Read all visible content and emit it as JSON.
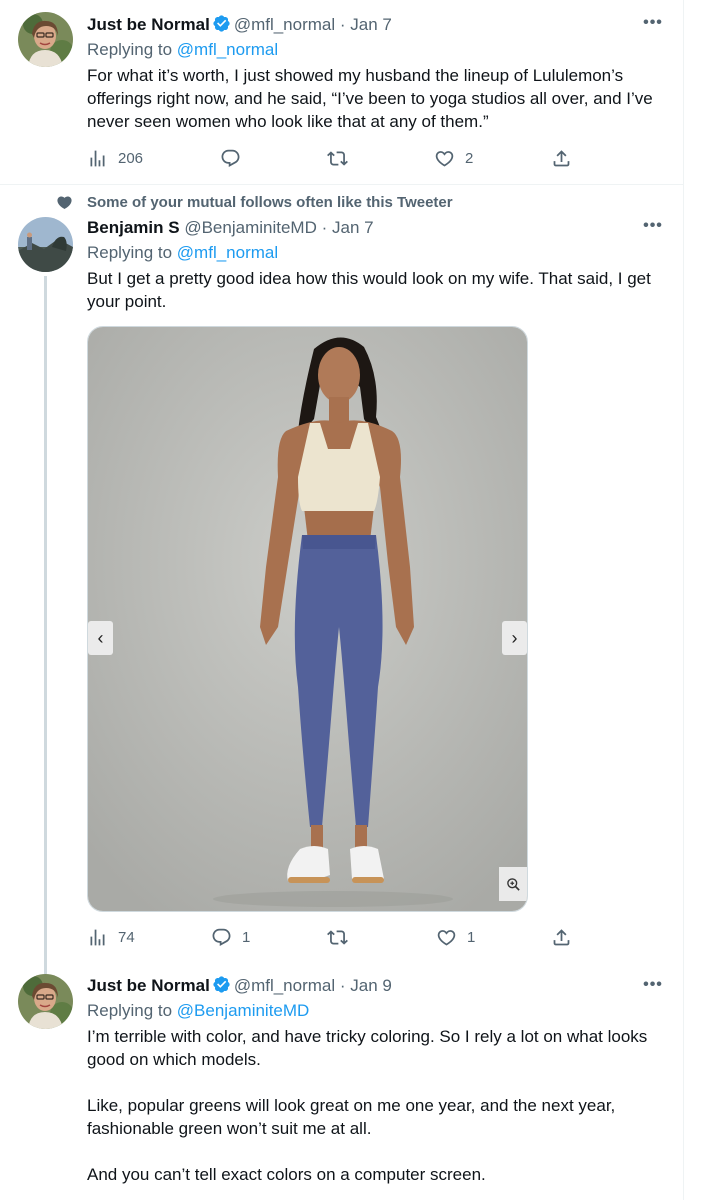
{
  "tweets": [
    {
      "name": "Just be Normal",
      "handle": "@mfl_normal",
      "separator": "·",
      "date": "Jan 7",
      "replying_prefix": "Replying to",
      "replying_to": "@mfl_normal",
      "text": "For what it’s worth, I just showed my husband the lineup of Lululemon’s offerings right now, and he said, “I’ve been to yoga studios all over, and I’ve never seen women who look like that at any of them.”",
      "stats": {
        "views": "206",
        "replies": "",
        "retweets": "",
        "likes": "2"
      }
    },
    {
      "social_context": "Some of your mutual follows often like this Tweeter",
      "name": "Benjamin S",
      "handle": "@BenjaminiteMD",
      "separator": "·",
      "date": "Jan 7",
      "replying_prefix": "Replying to",
      "replying_to": "@mfl_normal",
      "text": "But I get a pretty good idea how this would look on my wife. That said, I get your point.",
      "stats": {
        "views": "74",
        "replies": "1",
        "retweets": "",
        "likes": "1"
      }
    },
    {
      "name": "Just be Normal",
      "handle": "@mfl_normal",
      "separator": "·",
      "date": "Jan 9",
      "replying_prefix": "Replying to",
      "replying_to": "@BenjaminiteMD",
      "paragraphs": [
        "I’m terrible with color, and have tricky coloring. So I rely a lot on what looks good on which models.",
        "Like, popular greens will look great on me one year, and the next year, fashionable green won’t suit me at all.",
        "And you can’t tell exact colors on a computer screen."
      ]
    }
  ],
  "icons": {
    "verified": "verified-badge-icon",
    "more": "more-icon",
    "views": "views-icon",
    "reply": "reply-icon",
    "retweet": "retweet-icon",
    "like": "like-icon",
    "share": "share-icon",
    "heart_small": "heart-icon",
    "carousel_prev": "chevron-left-icon",
    "carousel_next": "chevron-right-icon",
    "zoom": "zoom-icon"
  },
  "colors": {
    "link": "#1d9bf0",
    "secondary": "#536471",
    "thread_line": "#cfd9de"
  }
}
